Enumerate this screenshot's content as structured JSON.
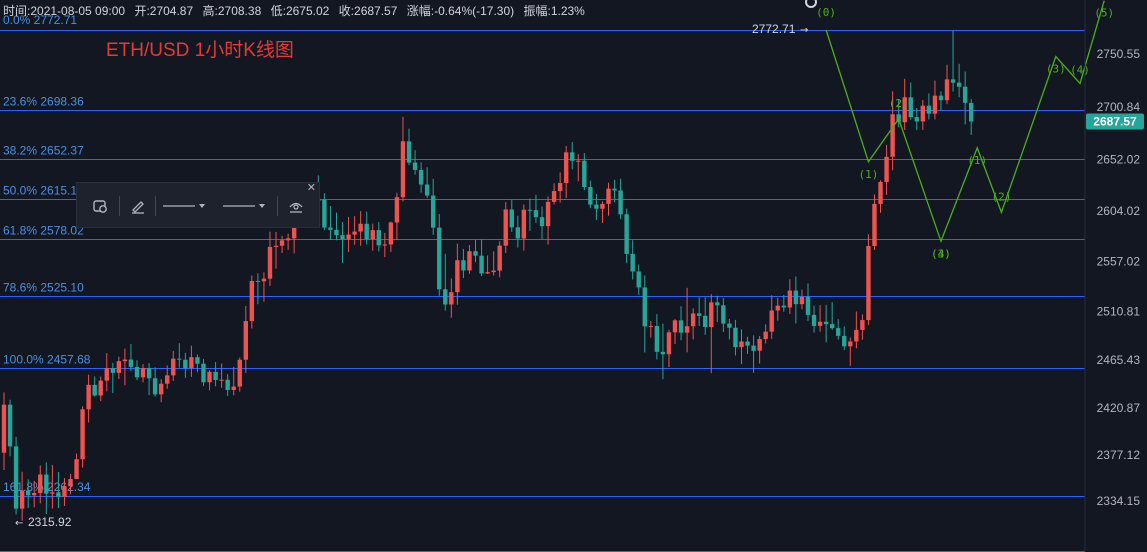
{
  "ohlc_bar": {
    "time_label": "时间:",
    "time": "2021-08-05 09:00",
    "open_label": "开:",
    "open": "2704.87",
    "high_label": "高:",
    "high": "2708.38",
    "low_label": "低:",
    "low": "2675.02",
    "close_label": "收:",
    "close": "2687.57",
    "change_label": "涨幅:",
    "change": "-0.64%(-17.30)",
    "amplitude_label": "振幅:",
    "amplitude": "1.23%"
  },
  "colors": {
    "background": "#131722",
    "up": "#ef5350",
    "down": "#26a69a",
    "fib_line": "#2962ff",
    "fib_text": "#4a90e2",
    "wave": "#4caf1a",
    "title": "#e53935",
    "axis_text": "#b2b5be",
    "price_badge": "#26a69a"
  },
  "chart_data": {
    "type": "candlestick",
    "title": "ETH/USD 1小时K线图",
    "y_ticks": [
      "2750.55",
      "2700.84",
      "2652.02",
      "2604.02",
      "2557.02",
      "2510.81",
      "2465.43",
      "2420.87",
      "2377.12",
      "2334.15"
    ],
    "ylim": [
      2305,
      2780
    ],
    "current_price": "2687.57",
    "high_marker": "2772.71",
    "low_marker": "2315.92",
    "fib_levels": [
      {
        "label": "0.0% 2772.71",
        "value": 2772.71
      },
      {
        "label": "23.6% 2698.36",
        "value": 2698.36
      },
      {
        "label": "38.2% 2652.37",
        "value": 2652.37
      },
      {
        "label": "50.0% 2615.19",
        "value": 2615.19
      },
      {
        "label": "61.8% 2578.02",
        "value": 2578.02
      },
      {
        "label": "78.6% 2525.10",
        "value": 2525.1
      },
      {
        "label": "100.0% 2457.68",
        "value": 2457.68
      },
      {
        "label": "161.8% 2262.34",
        "value": 2262.34
      },
      {
        "label": "",
        "value": 2338.4
      }
    ],
    "wave_points": [
      {
        "label": "(0)",
        "price": 2772.71,
        "bar": 136
      },
      {
        "label": "(1)",
        "price": 2650,
        "bar": 143
      },
      {
        "label": "(2)",
        "price": 2690,
        "bar": 148
      },
      {
        "label": "(3)",
        "price": 2576,
        "bar": 155
      },
      {
        "label": "(4)",
        "price": 2576,
        "bar": 155
      },
      {
        "label": "(1)",
        "price": 2663,
        "bar": 161
      },
      {
        "label": "(2)",
        "price": 2603,
        "bar": 165
      },
      {
        "label": "(3)",
        "price": 2748,
        "bar": 174
      },
      {
        "label": "(4)",
        "price": 2723,
        "bar": 178
      },
      {
        "label": "(5)",
        "price": 2800,
        "bar": 182
      }
    ],
    "candles": [
      [
        2379.16,
        2435.31,
        2363.03,
        2423.88
      ],
      [
        2423.88,
        2428.48,
        2375.89,
        2385.04
      ],
      [
        2385.04,
        2393.93,
        2321.71,
        2327.11
      ],
      [
        2327.11,
        2361.49,
        2315.92,
        2343.97
      ],
      [
        2343.97,
        2354.38,
        2327.79,
        2339.55
      ],
      [
        2339.55,
        2352.94,
        2328.31,
        2341.63
      ],
      [
        2341.63,
        2367.38,
        2332.01,
        2358.87
      ],
      [
        2358.87,
        2370.2,
        2322.04,
        2341.03
      ],
      [
        2341.03,
        2367.85,
        2327.19,
        2342.25
      ],
      [
        2342.25,
        2361.28,
        2327.66,
        2338.26
      ],
      [
        2338.26,
        2355.59,
        2329.58,
        2347.87
      ],
      [
        2347.87,
        2359.59,
        2340.42,
        2354.68
      ],
      [
        2354.68,
        2378.39,
        2354.68,
        2373.11
      ],
      [
        2373.11,
        2422.38,
        2365.36,
        2419.57
      ],
      [
        2419.57,
        2451.82,
        2407.36,
        2442.38
      ],
      [
        2442.38,
        2450.23,
        2431.38,
        2432.43
      ],
      [
        2432.43,
        2450.18,
        2427.29,
        2446.32
      ],
      [
        2446.32,
        2471.95,
        2436.4,
        2457.88
      ],
      [
        2457.88,
        2462.81,
        2434.73,
        2453.53
      ],
      [
        2453.53,
        2468.6,
        2447.86,
        2464.4
      ],
      [
        2464.4,
        2476.22,
        2441.97,
        2465.91
      ],
      [
        2465.91,
        2480.42,
        2455.03,
        2459.08
      ],
      [
        2459.08,
        2465.22,
        2446.81,
        2449.4
      ],
      [
        2449.4,
        2461.66,
        2444.6,
        2458.01
      ],
      [
        2458.01,
        2462.62,
        2432.75,
        2448.49
      ],
      [
        2448.49,
        2458.72,
        2431.45,
        2433.47
      ],
      [
        2433.47,
        2447.66,
        2426.13,
        2443.43
      ],
      [
        2443.43,
        2460.42,
        2438.62,
        2451.15
      ],
      [
        2451.15,
        2473.85,
        2445.86,
        2466.7
      ],
      [
        2466.7,
        2481.11,
        2458.39,
        2465.75
      ],
      [
        2465.75,
        2472.1,
        2448.99,
        2457.9
      ],
      [
        2457.9,
        2478.74,
        2449.8,
        2468.11
      ],
      [
        2468.11,
        2470.64,
        2454.18,
        2462.03
      ],
      [
        2462.03,
        2466.56,
        2441.12,
        2444.74
      ],
      [
        2444.74,
        2456.06,
        2437.17,
        2454.47
      ],
      [
        2454.47,
        2463.54,
        2441.02,
        2446.93
      ],
      [
        2446.93,
        2462.21,
        2439.61,
        2447.07
      ],
      [
        2447.07,
        2452.34,
        2432.04,
        2437.6
      ],
      [
        2437.6,
        2459.11,
        2432.65,
        2440.76
      ],
      [
        2440.76,
        2467.85,
        2436.03,
        2465.76
      ],
      [
        2465.76,
        2515.75,
        2453.5,
        2501.74
      ],
      [
        2501.74,
        2544.01,
        2494.79,
        2539.01
      ],
      [
        2539.01,
        2546.26,
        2517.41,
        2538.72
      ],
      [
        2538.72,
        2547.14,
        2519.73,
        2541.21
      ],
      [
        2541.21,
        2584.94,
        2534.38,
        2570.75
      ],
      [
        2570.75,
        2584.61,
        2550.44,
        2571.85
      ],
      [
        2571.85,
        2581.13,
        2564.95,
        2576.9
      ],
      [
        2576.9,
        2583.02,
        2567.91,
        2578.71
      ],
      [
        2578.71,
        2629.7,
        2564.74,
        2612.41
      ],
      [
        2612.41,
        2629.73,
        2604.91,
        2617.61
      ],
      [
        2617.61,
        2626.73,
        2603.72,
        2617.54
      ],
      [
        2617.54,
        2629.04,
        2605.46,
        2614.64
      ],
      [
        2614.64,
        2637.33,
        2602.52,
        2614.6
      ],
      [
        2614.6,
        2620.8,
        2586.61,
        2588.81
      ],
      [
        2588.81,
        2608.89,
        2577.13,
        2586.66
      ],
      [
        2586.66,
        2602.76,
        2576.98,
        2581.7
      ],
      [
        2581.7,
        2593.81,
        2555.84,
        2577.74
      ],
      [
        2577.74,
        2598.65,
        2566.02,
        2582.24
      ],
      [
        2582.24,
        2599.45,
        2572.85,
        2585.05
      ],
      [
        2585.05,
        2604.05,
        2571.81,
        2592.32
      ],
      [
        2592.32,
        2603.65,
        2573.03,
        2577.99
      ],
      [
        2577.99,
        2592.41,
        2567.19,
        2586.39
      ],
      [
        2586.39,
        2594.03,
        2566.55,
        2572.23
      ],
      [
        2572.23,
        2583.73,
        2561.31,
        2573.02
      ],
      [
        2573.02,
        2594.45,
        2566.09,
        2593.53
      ],
      [
        2593.53,
        2621.17,
        2577.4,
        2617.06
      ],
      [
        2617.06,
        2691.84,
        2613.05,
        2669.08
      ],
      [
        2669.08,
        2680.88,
        2646.81,
        2649.28
      ],
      [
        2649.28,
        2660.87,
        2638.11,
        2642.47
      ],
      [
        2642.47,
        2649.52,
        2621.3,
        2628.87
      ],
      [
        2628.87,
        2644.92,
        2616.38,
        2618.61
      ],
      [
        2618.61,
        2634.1,
        2581.99,
        2588.7
      ],
      [
        2588.7,
        2601.45,
        2525.3,
        2531.34
      ],
      [
        2531.34,
        2564.41,
        2511.58,
        2517.17
      ],
      [
        2517.17,
        2541.44,
        2504.8,
        2528.65
      ],
      [
        2528.65,
        2573.76,
        2516.96,
        2558.37
      ],
      [
        2558.37,
        2568.95,
        2541.73,
        2548.87
      ],
      [
        2548.87,
        2572.45,
        2545.7,
        2566.72
      ],
      [
        2566.72,
        2577.14,
        2556.54,
        2562.6
      ],
      [
        2562.6,
        2577.74,
        2543.55,
        2546.02
      ],
      [
        2546.02,
        2562.76,
        2545.58,
        2547.27
      ],
      [
        2547.27,
        2566.66,
        2544.2,
        2548.69
      ],
      [
        2548.69,
        2576.05,
        2542.51,
        2571.91
      ],
      [
        2571.91,
        2612.44,
        2565.03,
        2605.59
      ],
      [
        2605.59,
        2614.79,
        2584.69,
        2589.01
      ],
      [
        2589.01,
        2599.82,
        2570.15,
        2578.67
      ],
      [
        2578.67,
        2610.29,
        2567.31,
        2605.38
      ],
      [
        2605.38,
        2615.79,
        2585.57,
        2605.03
      ],
      [
        2605.03,
        2619.29,
        2593.03,
        2598.43
      ],
      [
        2598.43,
        2608.38,
        2577.42,
        2590.13
      ],
      [
        2590.13,
        2617.75,
        2573.07,
        2612.74
      ],
      [
        2612.74,
        2629.91,
        2610.25,
        2622.74
      ],
      [
        2622.74,
        2640.16,
        2612.04,
        2630.25
      ],
      [
        2630.25,
        2664.84,
        2616.26,
        2658.82
      ],
      [
        2658.82,
        2668.38,
        2643.1,
        2650.94
      ],
      [
        2650.94,
        2657.13,
        2631.91,
        2650.97
      ],
      [
        2650.97,
        2658.21,
        2623.46,
        2626.56
      ],
      [
        2626.56,
        2632.56,
        2606.87,
        2610.18
      ],
      [
        2610.18,
        2620.18,
        2595.79,
        2606.32
      ],
      [
        2606.32,
        2613.25,
        2593.07,
        2610.81
      ],
      [
        2610.81,
        2630.62,
        2599.75,
        2625.04
      ],
      [
        2625.04,
        2633.18,
        2612.31,
        2623.32
      ],
      [
        2623.32,
        2634.24,
        2596.53,
        2601.16
      ],
      [
        2601.16,
        2606.43,
        2555.49,
        2564.24
      ],
      [
        2564.24,
        2577.05,
        2540.42,
        2547.86
      ],
      [
        2547.86,
        2554.44,
        2526.22,
        2533.05
      ],
      [
        2533.05,
        2544.21,
        2472.5,
        2496.83
      ],
      [
        2496.83,
        2501.8,
        2486.27,
        2497.07
      ],
      [
        2497.07,
        2508.17,
        2466.05,
        2473.08
      ],
      [
        2473.08,
        2499.45,
        2447.7,
        2470.81
      ],
      [
        2470.81,
        2493.71,
        2458.9,
        2491.27
      ],
      [
        2491.27,
        2503.51,
        2480.36,
        2502.41
      ],
      [
        2502.41,
        2515.54,
        2483.89,
        2490.98
      ],
      [
        2490.98,
        2532.65,
        2472.65,
        2496.9
      ],
      [
        2496.9,
        2513.55,
        2484.61,
        2508.83
      ],
      [
        2508.83,
        2523.85,
        2497.07,
        2506.6
      ],
      [
        2506.6,
        2523.91,
        2488.87,
        2496.19
      ],
      [
        2496.19,
        2526.77,
        2453.2,
        2519.16
      ],
      [
        2519.16,
        2525.24,
        2500.8,
        2516.41
      ],
      [
        2516.41,
        2523.18,
        2491.55,
        2499.4
      ],
      [
        2499.4,
        2503.8,
        2484.62,
        2495.53
      ],
      [
        2495.53,
        2502.82,
        2469.69,
        2477.48
      ],
      [
        2477.48,
        2493.9,
        2461.63,
        2482.71
      ],
      [
        2482.71,
        2487.16,
        2471.11,
        2478.85
      ],
      [
        2478.85,
        2488.38,
        2453.55,
        2474.08
      ],
      [
        2474.08,
        2487.79,
        2462.14,
        2484.99
      ],
      [
        2484.99,
        2498.69,
        2480.88,
        2491.89
      ],
      [
        2491.89,
        2525.74,
        2485.21,
        2511.61
      ],
      [
        2511.61,
        2523.38,
        2502.14,
        2516.08
      ],
      [
        2516.08,
        2526.06,
        2510.37,
        2514.43
      ],
      [
        2514.43,
        2540.65,
        2508.32,
        2530.1
      ],
      [
        2530.1,
        2543.27,
        2499.51,
        2517.48
      ],
      [
        2517.48,
        2531.1,
        2512.77,
        2524.29
      ],
      [
        2524.29,
        2536.7,
        2501.85,
        2507.47
      ],
      [
        2507.47,
        2515.99,
        2491.06,
        2497.25
      ],
      [
        2497.25,
        2516.57,
        2491.84,
        2501.06
      ],
      [
        2501.06,
        2516.82,
        2481.97,
        2498.89
      ],
      [
        2498.89,
        2519.27,
        2493.52,
        2495.16
      ],
      [
        2495.16,
        2503.58,
        2484.45,
        2487.93
      ],
      [
        2487.93,
        2496.73,
        2474.77,
        2478.25
      ],
      [
        2478.25,
        2486.42,
        2460.03,
        2482.72
      ],
      [
        2482.72,
        2510.61,
        2476.37,
        2493.52
      ],
      [
        2493.52,
        2507.95,
        2484.42,
        2502.68
      ],
      [
        2502.68,
        2582.5,
        2497.94,
        2571.63
      ],
      [
        2571.63,
        2619.65,
        2567.92,
        2610.8
      ],
      [
        2610.8,
        2632.81,
        2602.54,
        2631.25
      ],
      [
        2631.25,
        2665.76,
        2619.29,
        2654.67
      ],
      [
        2654.67,
        2715.64,
        2642.16,
        2694.26
      ],
      [
        2694.26,
        2707.94,
        2682.2,
        2686.88
      ],
      [
        2686.88,
        2727.3,
        2679.63,
        2710.06
      ],
      [
        2710.06,
        2723.84,
        2689.18,
        2691.58
      ],
      [
        2691.58,
        2700.06,
        2679.71,
        2687.62
      ],
      [
        2687.62,
        2707.52,
        2679.57,
        2702.28
      ],
      [
        2702.28,
        2713.6,
        2689.44,
        2694.82
      ],
      [
        2694.82,
        2725.63,
        2689.41,
        2711.61
      ],
      [
        2711.61,
        2715.53,
        2697.81,
        2707.4
      ],
      [
        2707.4,
        2740.4,
        2703.67,
        2726.73
      ],
      [
        2726.73,
        2772.71,
        2715.39,
        2723.66
      ],
      [
        2723.66,
        2741.27,
        2710.14,
        2719.86
      ],
      [
        2719.86,
        2734.06,
        2684.82,
        2704.87
      ],
      [
        2704.87,
        2708.38,
        2675.02,
        2687.57
      ]
    ]
  }
}
